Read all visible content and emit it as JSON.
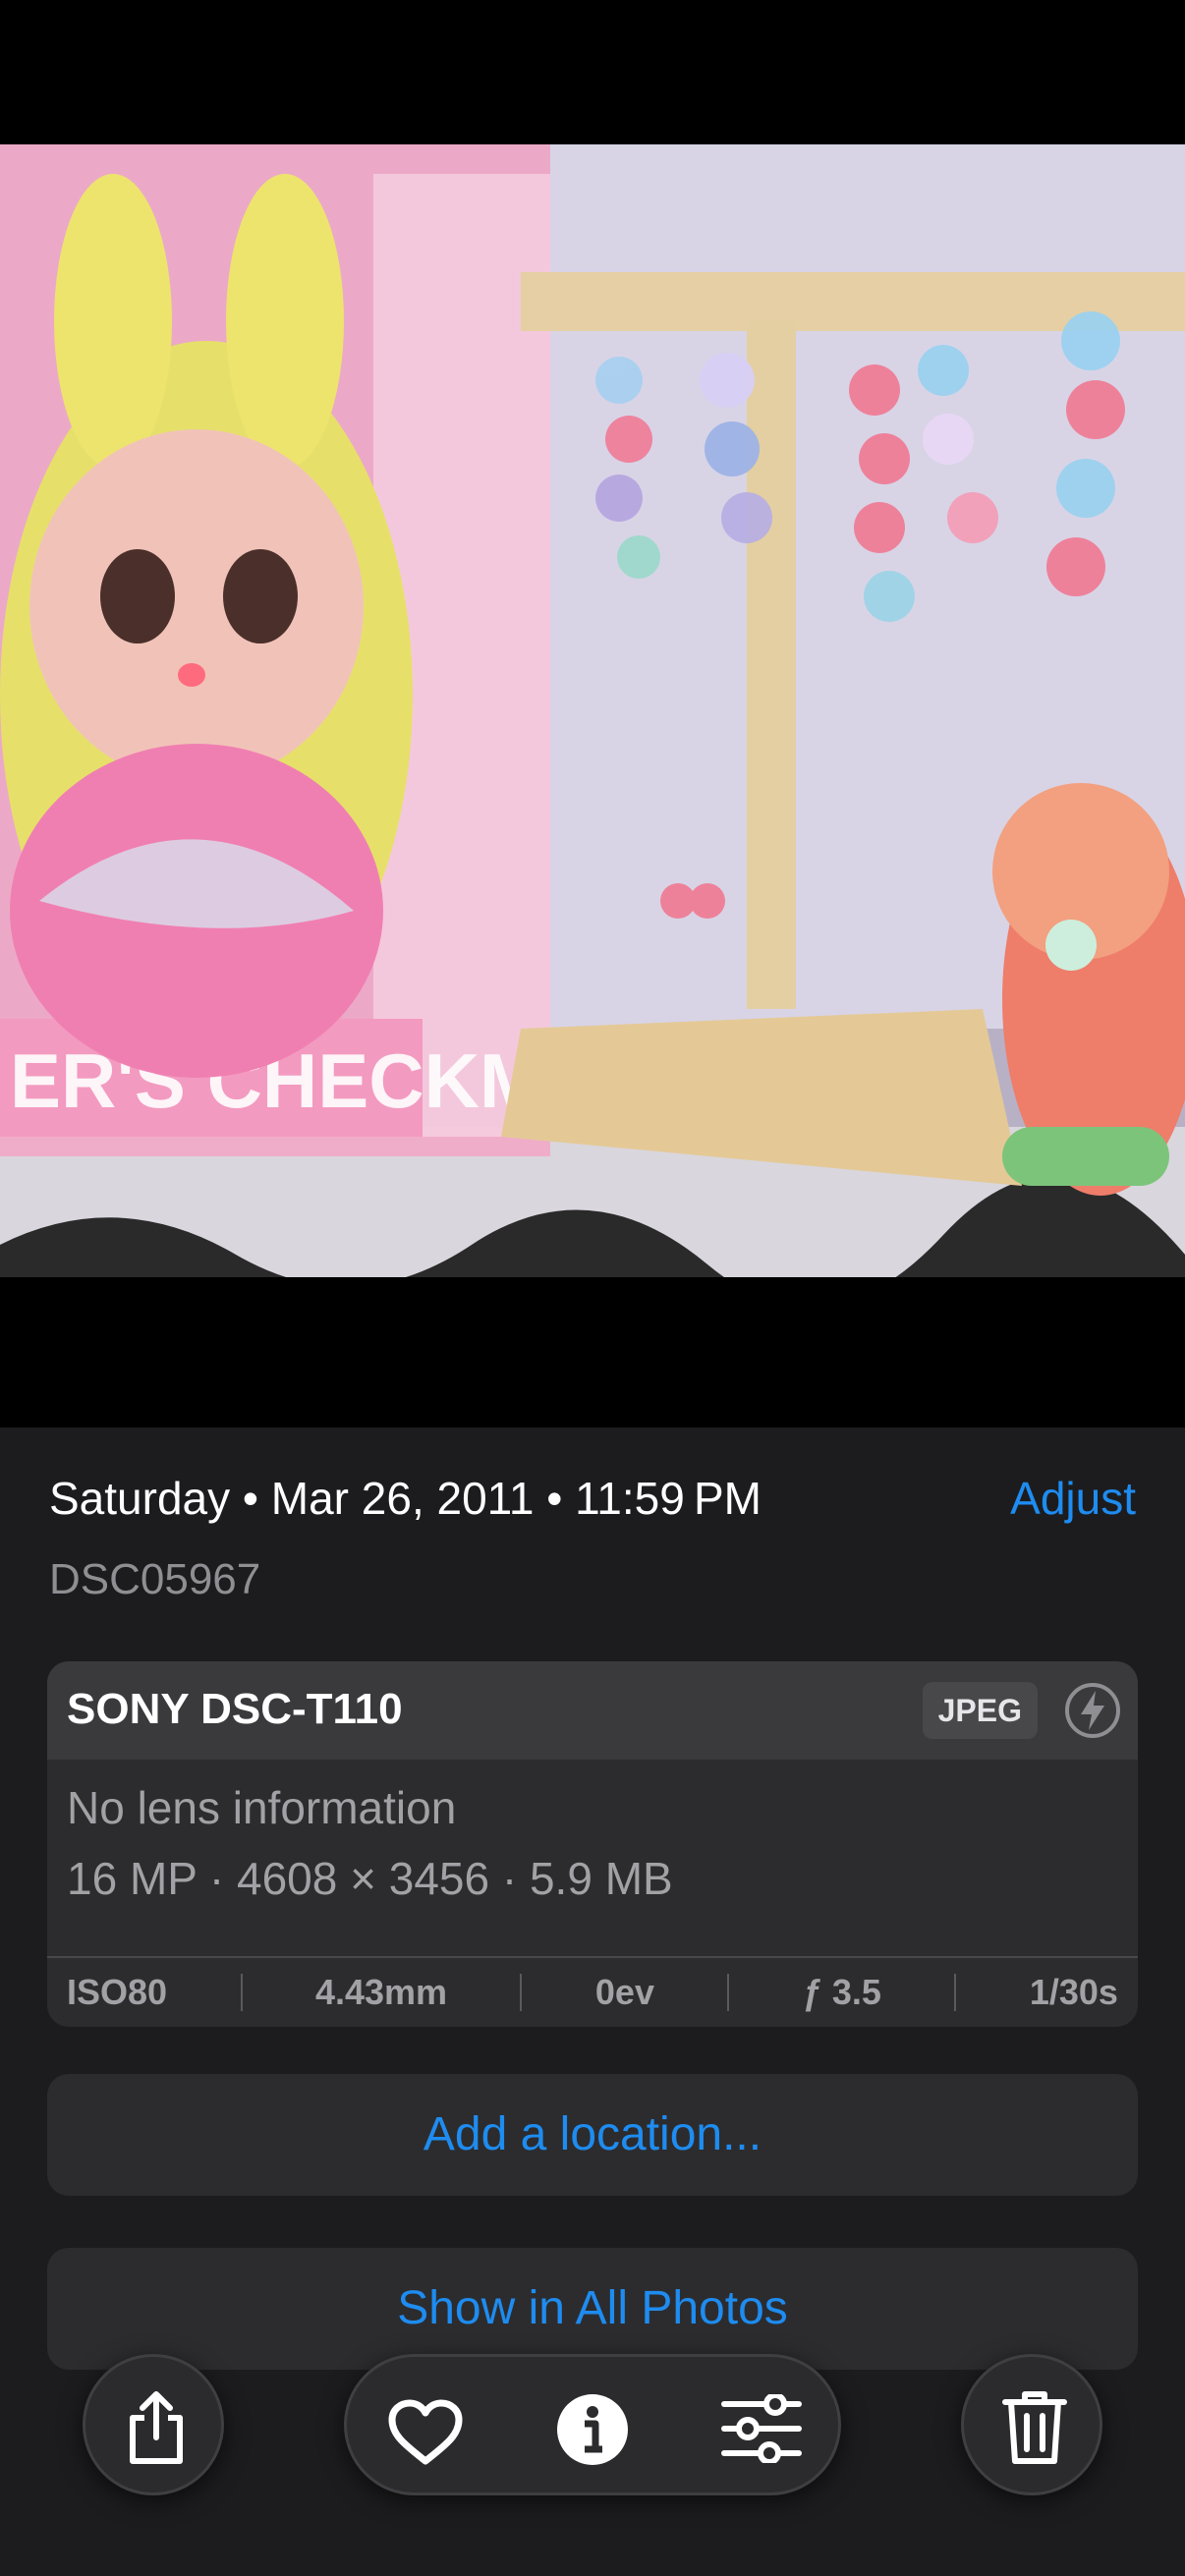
{
  "info": {
    "date": "Saturday • Mar 26, 2011 • 11:59 PM",
    "adjust_label": "Adjust",
    "filename": "DSC05967"
  },
  "camera_card": {
    "camera_model": "SONY DSC-T110",
    "format_badge": "JPEG",
    "flash_icon": "flash-off-icon",
    "lens": "No lens information",
    "specs": "16 MP · 4608 × 3456 · 5.9 MB",
    "exif": [
      "ISO80",
      "4.43mm",
      "0ev",
      "ƒ 3.5",
      "1/30s"
    ]
  },
  "actions": {
    "add_location": "Add a location...",
    "show_all_photos": "Show in All Photos"
  },
  "toolbar": {
    "share_icon": "share-icon",
    "favorite_icon": "heart-icon",
    "info_icon": "info-icon",
    "adjust_icon": "sliders-icon",
    "delete_icon": "trash-icon"
  },
  "colors": {
    "accent": "#1e8cf0",
    "panel": "#1c1c1e",
    "card": "#2c2c2e"
  }
}
